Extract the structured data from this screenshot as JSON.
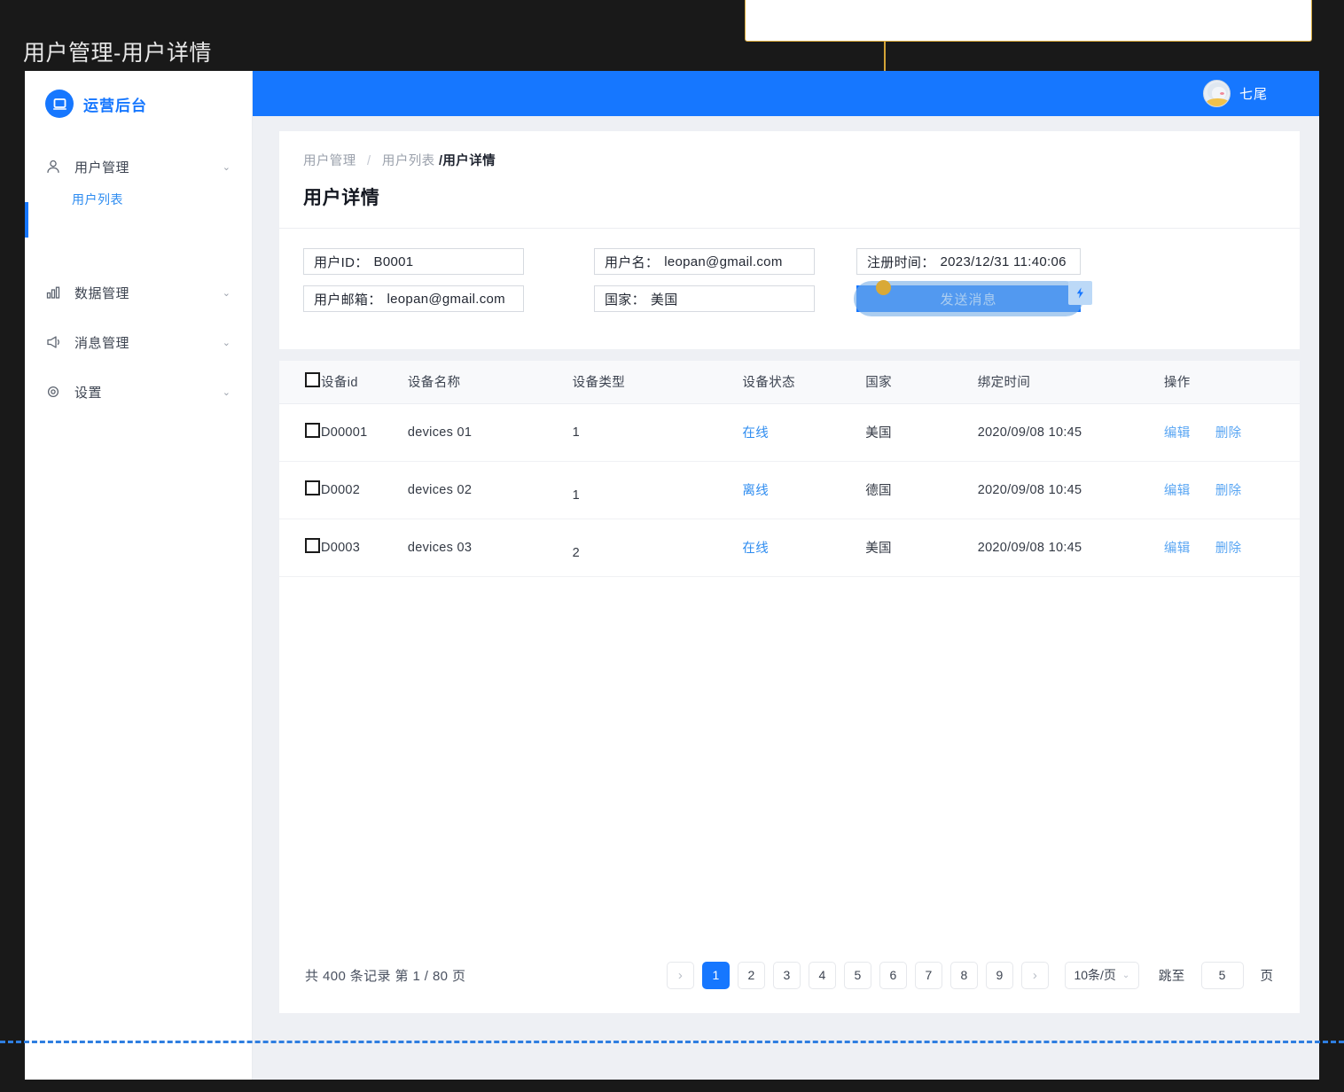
{
  "caption": "用户管理-用户详情",
  "sidebar": {
    "logo_text": "运营后台",
    "logo_icon": "monitor-icon",
    "items": [
      {
        "label": "用户管理",
        "icon": "user-icon",
        "caret": "⌄"
      },
      {
        "label": "数据管理",
        "icon": "bar-chart-icon",
        "caret": "⌄"
      },
      {
        "label": "消息管理",
        "icon": "megaphone-icon",
        "caret": "⌄"
      },
      {
        "label": "设置",
        "icon": "gear-icon",
        "caret": "⌄"
      }
    ],
    "submenu": {
      "label": "用户列表"
    }
  },
  "topbar": {
    "user_name": "七尾",
    "avatar_icon": "avatar-icon"
  },
  "breadcrumb": {
    "first": "用户管理",
    "separator": "/",
    "second": "用户列表",
    "current": "/用户详情"
  },
  "page_title": "用户详情",
  "form": {
    "user_id_label": "用户ID：",
    "user_id_value": "B0001",
    "user_name_label": "用户名：",
    "user_name_value": "leopan@gmail.com",
    "user_email_label": "用户邮箱：",
    "user_email_value": "leopan@gmail.com",
    "country_label": "国家：",
    "country_value": "美国",
    "reg_time_label": "注册时间：",
    "reg_time_value": "2023/12/31 11:40:06",
    "send_button": "发送消息",
    "bolt_icon": "lightning-bolt-icon"
  },
  "table": {
    "columns": [
      "设备id",
      "设备名称",
      "设备类型",
      "设备状态",
      "国家",
      "绑定时间",
      "操作"
    ],
    "rows": [
      {
        "device_id": "D00001",
        "device_name": "devices 01",
        "device_type": "1",
        "status": "在线",
        "country": "美国",
        "bind_time": "2020/09/08 10:45",
        "edit": "编辑",
        "delete": "删除"
      },
      {
        "device_id": "D0002",
        "device_name": "devices 02",
        "device_type": "1",
        "status": "离线",
        "country": "德国",
        "bind_time": "2020/09/08 10:45",
        "edit": "编辑",
        "delete": "删除"
      },
      {
        "device_id": "D0003",
        "device_name": "devices 03",
        "device_type": "2",
        "status": "在线",
        "country": "美国",
        "bind_time": "2020/09/08 10:45",
        "edit": "编辑",
        "delete": "删除"
      }
    ]
  },
  "pagination": {
    "summary": "共 400 条记录 第 1 / 80 页",
    "prev_icon": "chevron-right-icon",
    "next_icon": "chevron-right-icon",
    "pages": [
      "1",
      "2",
      "3",
      "4",
      "5",
      "6",
      "7",
      "8",
      "9"
    ],
    "active_page": "1",
    "page_size": "10条/页",
    "size_caret": "⌄",
    "jump_label": "跳至",
    "jump_value": "5",
    "jump_unit": "页"
  },
  "colors": {
    "primary": "#1677ff",
    "link": "#2e8cf0",
    "annotation": "#d4a437",
    "guide": "#2f7ee0",
    "canvas": "#191919"
  }
}
